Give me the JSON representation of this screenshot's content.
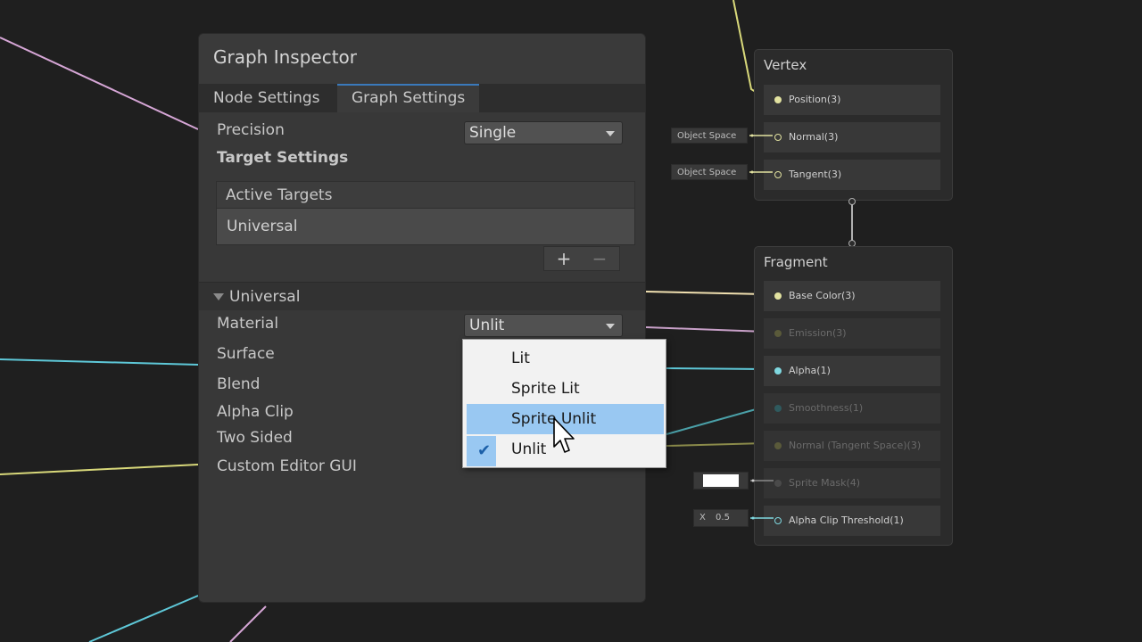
{
  "inspector": {
    "title": "Graph Inspector",
    "tabs": [
      {
        "label": "Node Settings",
        "active": false
      },
      {
        "label": "Graph Settings",
        "active": true
      }
    ],
    "precision": {
      "label": "Precision",
      "value": "Single"
    },
    "target_settings": {
      "heading": "Target Settings",
      "list_header": "Active Targets",
      "items": [
        "Universal"
      ],
      "add_label": "+",
      "remove_label": "−"
    },
    "section": {
      "title": "Universal"
    },
    "material": {
      "label": "Material",
      "value": "Unlit"
    },
    "labels": {
      "surface": "Surface",
      "blend": "Blend",
      "alpha_clip": "Alpha Clip",
      "two_sided": "Two Sided",
      "custom_editor": "Custom Editor GUI"
    }
  },
  "material_menu": {
    "options": [
      {
        "label": "Lit",
        "highlighted": false,
        "checked": false
      },
      {
        "label": "Sprite Lit",
        "highlighted": false,
        "checked": false
      },
      {
        "label": "Sprite Unlit",
        "highlighted": true,
        "checked": false
      },
      {
        "label": "Unlit",
        "highlighted": false,
        "checked": true
      }
    ]
  },
  "vertex_node": {
    "title": "Vertex",
    "slots": [
      "Position(3)",
      "Normal(3)",
      "Tangent(3)"
    ],
    "inline_fields": [
      "Object Space",
      "Object Space"
    ]
  },
  "fragment_node": {
    "title": "Fragment",
    "slots": [
      {
        "label": "Base Color(3)",
        "active": true
      },
      {
        "label": "Emission(3)",
        "active": false
      },
      {
        "label": "Alpha(1)",
        "active": true
      },
      {
        "label": "Smoothness(1)",
        "active": false
      },
      {
        "label": "Normal (Tangent Space)(3)",
        "active": false
      },
      {
        "label": "Sprite Mask(4)",
        "active": false
      },
      {
        "label": "Alpha Clip Threshold(1)",
        "active": true
      }
    ],
    "alpha_clip_input": {
      "axis": "X",
      "value": "0.5"
    }
  },
  "colors": {
    "wire_yellow": "#d8d87a",
    "wire_cyan": "#5ec8d8",
    "wire_pink": "#d6a6d6",
    "highlight": "#99c8f2",
    "tab_accent": "#3a79bb"
  }
}
